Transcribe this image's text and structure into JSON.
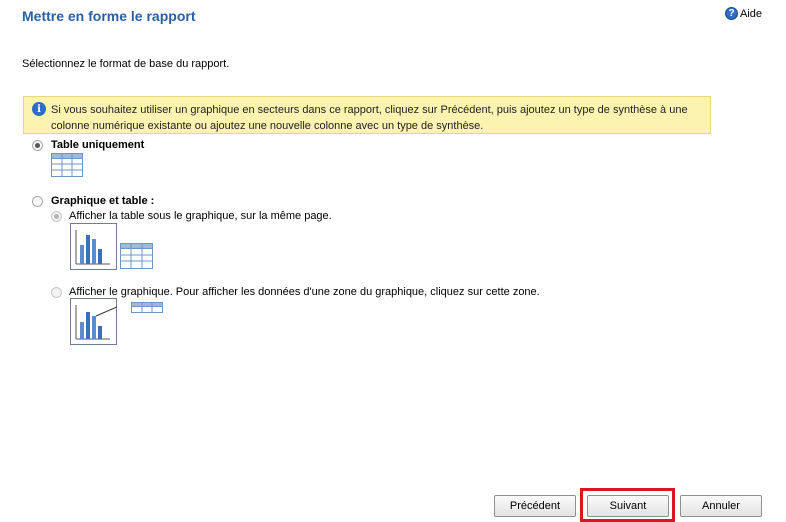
{
  "header": {
    "title": "Mettre en forme le rapport",
    "help_label": "Aide"
  },
  "subtitle": "Sélectionnez le format de base du rapport.",
  "info": {
    "text": "Si vous souhaitez utiliser un graphique en secteurs dans ce rapport, cliquez sur Précédent, puis ajoutez un type de synthèse à une colonne numérique existante ou ajoutez une nouvelle colonne avec un type de synthèse."
  },
  "options": {
    "table_only": {
      "label": "Table uniquement",
      "selected": true
    },
    "chart_and_table": {
      "label": "Graphique et table :",
      "selected": false
    },
    "sub_table_under_chart": {
      "label": "Afficher la table sous le graphique, sur la même page.",
      "selected": true,
      "disabled": true
    },
    "sub_chart_only": {
      "label": "Afficher le graphique. Pour afficher les données d'une zone du graphique, cliquez sur cette zone.",
      "selected": false,
      "disabled": true
    }
  },
  "buttons": {
    "previous": "Précédent",
    "next": "Suivant",
    "cancel": "Annuler"
  },
  "colors": {
    "title": "#2a5ea6",
    "info_bg": "#fcf3b1",
    "highlight": "#e0141e"
  },
  "icons": [
    "help-icon",
    "info-icon",
    "table-icon",
    "chart-icon"
  ]
}
